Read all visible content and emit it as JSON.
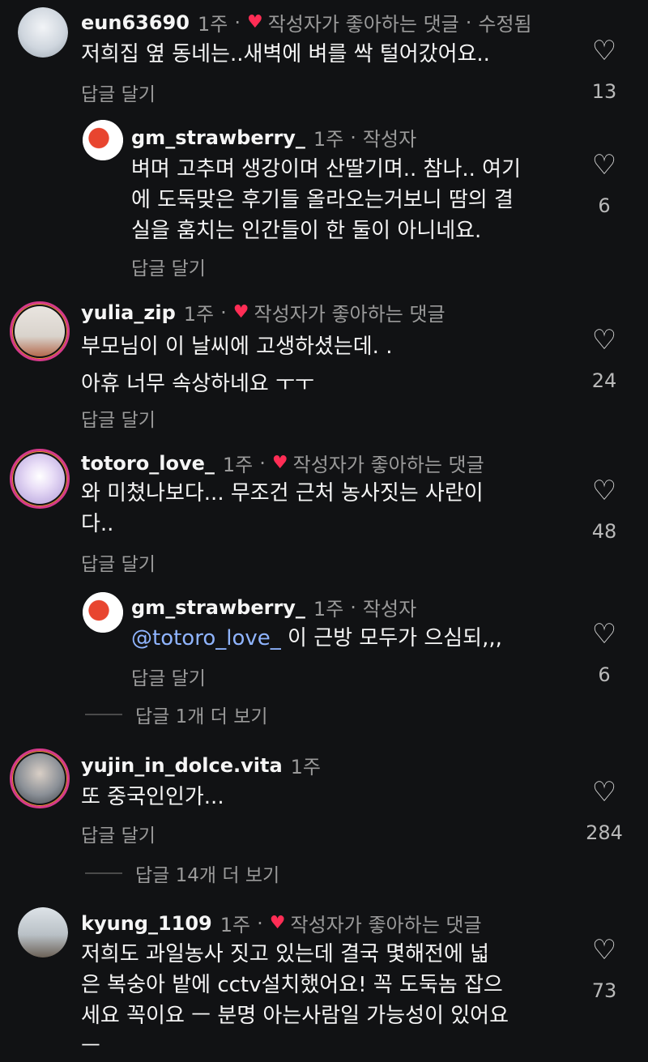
{
  "comments": [
    {
      "user": "eun63690",
      "time": "1주",
      "liked": "작성자가 좋아하는 댓글",
      "edited": "수정됨",
      "text": [
        "저희집 옆 동네는..새벽에  벼를 싹 털어갔어요.."
      ],
      "reply": "답글 달기",
      "likes": "13",
      "avatar_color": "#cfd6de"
    },
    {
      "user": "gm_strawberry_",
      "time": "1주",
      "author": "작성자",
      "text": [
        "벼며 고추며 생강이며 산딸기며.. 참나.. 여기",
        "에 도둑맞은 후기들 올라오는거보니 땀의 결",
        "실을 훔치는 인간들이 한 둘이 아니네요."
      ],
      "reply": "답글 달기",
      "likes": "6",
      "avatar_color": "#ffffff"
    },
    {
      "user": "yulia_zip",
      "time": "1주",
      "liked": "작성자가 좋아하는 댓글",
      "text": [
        "부모님이 이 날씨에 고생하셨는데. .",
        "아휴 너무 속상하네요 ㅜㅜ"
      ],
      "reply": "답글 달기",
      "likes": "24",
      "avatar_color": "#d9d3cc"
    },
    {
      "user": "totoro_love_",
      "time": "1주",
      "liked": "작성자가 좋아하는 댓글",
      "text": [
        "와 미쳤나보다... 무조건 근처 농사짓는 사란이",
        "다.."
      ],
      "reply": "답글 달기",
      "likes": "48",
      "avatar_color": "#c9b8e6"
    },
    {
      "user": "gm_strawberry_",
      "time": "1주",
      "author": "작성자",
      "mention": "@totoro_love_",
      "text": [
        "이 근방 모두가 으심되,,,"
      ],
      "reply": "답글 달기",
      "likes": "6",
      "avatar_color": "#ffffff"
    },
    {
      "user": "yujin_in_dolce.vita",
      "time": "1주",
      "text": [
        "또 중국인인가..."
      ],
      "reply": "답글 달기",
      "likes": "284",
      "avatar_color": "#8a8f96"
    },
    {
      "user": "kyung_1109",
      "time": "1주",
      "liked": "작성자가 좋아하는 댓글",
      "text": [
        "저희도 과일농사 짓고 있는데 결국 몇해전에  넓",
        "은 복숭아 밭에 cctv설치했어요!  꼭 도둑놈 잡으",
        "세요 꼭이요 ㅡ 분명 아는사람일 가능성이 있어요",
        "ㅡ"
      ],
      "likes": "73",
      "avatar_color": "#b9c0c6"
    }
  ],
  "more_replies": [
    "답글 1개 더 보기",
    "답글 14개 더 보기"
  ],
  "icons": {
    "heart": "heart-icon",
    "liked_badge": "heart-filled-icon"
  },
  "colors": {
    "background": "#111214",
    "mention": "#8fb4ff",
    "heart_red": "#ff2d55"
  }
}
